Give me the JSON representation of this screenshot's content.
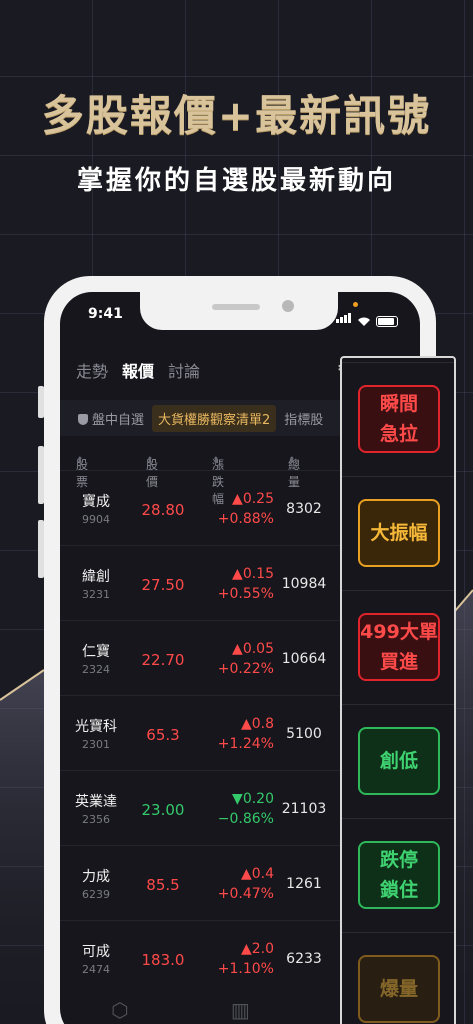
{
  "headline": "多股報價+最新訊號",
  "subline": "掌握你的自選股最新動向",
  "status": {
    "time": "9:41"
  },
  "tabs": [
    "走勢",
    "報價",
    "討論"
  ],
  "lists": [
    "盤中自選",
    "大貨權勝觀察清單2",
    "指標股"
  ],
  "columns": [
    "股票",
    "股價",
    "漲跌幅",
    "總量"
  ],
  "rows": [
    {
      "name": "寶成",
      "code": "9904",
      "price": "28.80",
      "chg": "▲0.25",
      "pct": "+0.88%",
      "vol": "8302",
      "dir": "up"
    },
    {
      "name": "緯創",
      "code": "3231",
      "price": "27.50",
      "chg": "▲0.15",
      "pct": "+0.55%",
      "vol": "10984",
      "dir": "up"
    },
    {
      "name": "仁寶",
      "code": "2324",
      "price": "22.70",
      "chg": "▲0.05",
      "pct": "+0.22%",
      "vol": "10664",
      "dir": "up"
    },
    {
      "name": "光寶科",
      "code": "2301",
      "price": "65.3",
      "chg": "▲0.8",
      "pct": "+1.24%",
      "vol": "5100",
      "dir": "up"
    },
    {
      "name": "英業達",
      "code": "2356",
      "price": "23.00",
      "chg": "▼0.20",
      "pct": "−0.86%",
      "vol": "21103",
      "dir": "down"
    },
    {
      "name": "力成",
      "code": "6239",
      "price": "85.5",
      "chg": "▲0.4",
      "pct": "+0.47%",
      "vol": "1261",
      "dir": "up"
    },
    {
      "name": "可成",
      "code": "2474",
      "price": "183.0",
      "chg": "▲2.0",
      "pct": "+1.10%",
      "vol": "6233",
      "dir": "up"
    }
  ],
  "signals": [
    {
      "label": "瞬間\n急拉",
      "color": "red"
    },
    {
      "label": "大振幅",
      "color": "orange"
    },
    {
      "label": "499大單\n買進",
      "color": "red"
    },
    {
      "label": "創低",
      "color": "green"
    },
    {
      "label": "跌停\n鎖住",
      "color": "green"
    },
    {
      "label": "爆量",
      "color": "orange"
    }
  ],
  "colors": {
    "up": "#ff4a4a",
    "down": "#34c96a",
    "gold": "#d8c39a",
    "active_list": "#e8b860"
  },
  "icons": {
    "settings": "gear-icon",
    "edit": "edit-icon"
  }
}
